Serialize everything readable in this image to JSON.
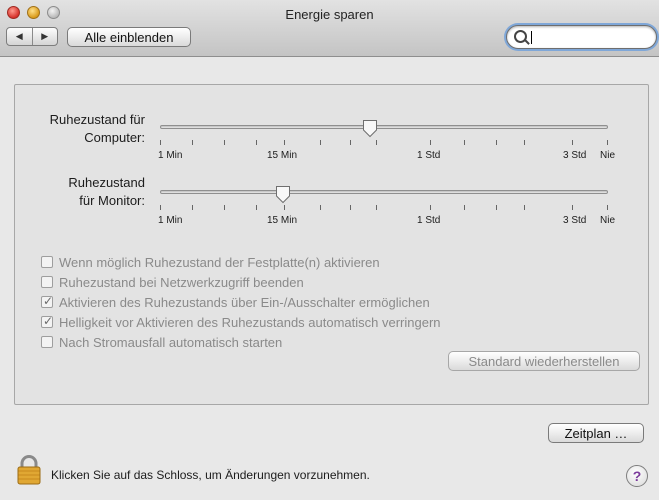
{
  "window": {
    "title": "Energie sparen"
  },
  "toolbar": {
    "back_glyph": "◀",
    "forward_glyph": "▶",
    "show_all_label": "Alle einblenden",
    "search_value": ""
  },
  "sliders": [
    {
      "label_line1": "Ruhezustand für",
      "label_line2": "Computer:",
      "value": "1 Std",
      "value_position": 0.47
    },
    {
      "label_line1": "Ruhezustand",
      "label_line2": "für Monitor:",
      "value": "15 Min",
      "value_position": 0.27
    }
  ],
  "slider_ticks": [
    "1 Min",
    "15 Min",
    "1 Std",
    "3 Std",
    "Nie"
  ],
  "checkboxes": [
    {
      "label": "Wenn möglich Ruhezustand der Festplatte(n) aktivieren",
      "checked": false,
      "enabled": false
    },
    {
      "label": "Ruhezustand bei Netzwerkzugriff beenden",
      "checked": false,
      "enabled": false
    },
    {
      "label": "Aktivieren des Ruhezustands über Ein-/Ausschalter ermöglichen",
      "checked": true,
      "enabled": false
    },
    {
      "label": "Helligkeit vor Aktivieren des Ruhezustands automatisch verringern",
      "checked": true,
      "enabled": false
    },
    {
      "label": "Nach Stromausfall automatisch starten",
      "checked": false,
      "enabled": false
    }
  ],
  "restore_defaults_label": "Standard wiederherstellen",
  "schedule_label": "Zeitplan …",
  "lock_text": "Klicken Sie auf das Schloss, um Änderungen vorzunehmen.",
  "help_glyph": "?",
  "colors": {
    "help_accent": "#7b3b9b",
    "search_focus": "#7fa7d8"
  }
}
